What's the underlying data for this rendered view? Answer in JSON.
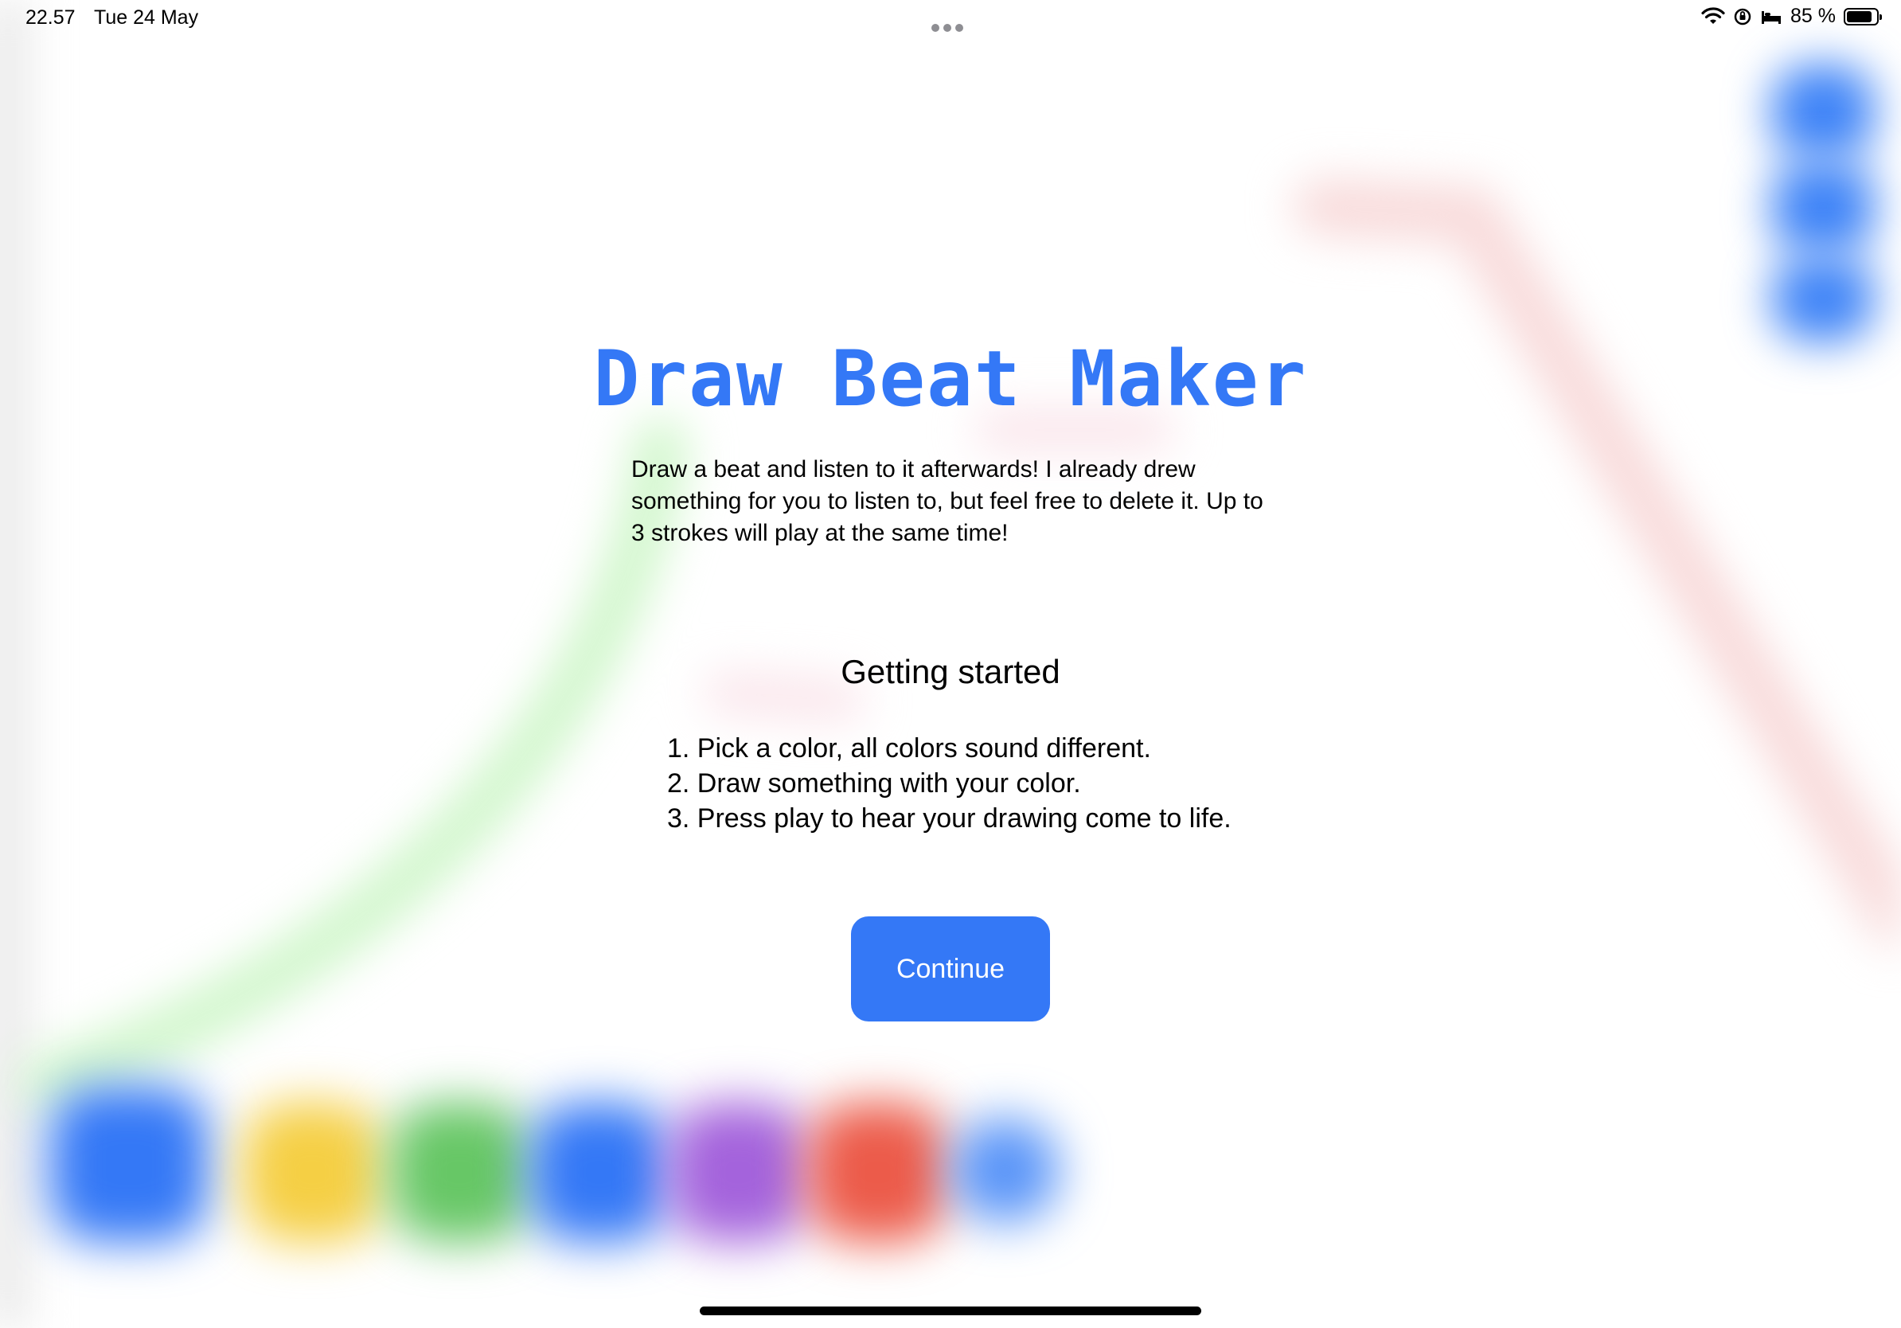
{
  "status_bar": {
    "time": "22.57",
    "date": "Tue 24 May",
    "battery_text": "85 %",
    "battery_level": 0.85,
    "icons": [
      "wifi-icon",
      "orientation-lock-icon",
      "sleep-icon",
      "battery-icon"
    ]
  },
  "onboarding": {
    "title": "Draw Beat Maker",
    "description": "Draw a beat and listen to it afterwards! I already drew something for you to listen to, but feel free to delete it. Up to 3 strokes will play at the same time!",
    "getting_started_heading": "Getting started",
    "steps": [
      "1. Pick a color, all colors sound different.",
      "2. Draw something with your color.",
      "3. Press play to hear your drawing come to life."
    ],
    "continue_label": "Continue"
  },
  "background": {
    "color_palette": [
      {
        "name": "blue",
        "color": "#3478f6"
      },
      {
        "name": "yellow",
        "color": "#f5cf44"
      },
      {
        "name": "green",
        "color": "#67c766"
      },
      {
        "name": "blue",
        "color": "#3478f6"
      },
      {
        "name": "purple",
        "color": "#a463dc"
      },
      {
        "name": "red",
        "color": "#ec5b4a"
      },
      {
        "name": "blue-small",
        "color": "#5a95f8"
      }
    ],
    "side_buttons_color": "#3f84f7",
    "stroke_colors": {
      "green": "#c8f5c4",
      "red": "#f7d2d2"
    }
  },
  "colors": {
    "accent": "#3478f6",
    "text": "#000000",
    "background": "#ffffff"
  }
}
